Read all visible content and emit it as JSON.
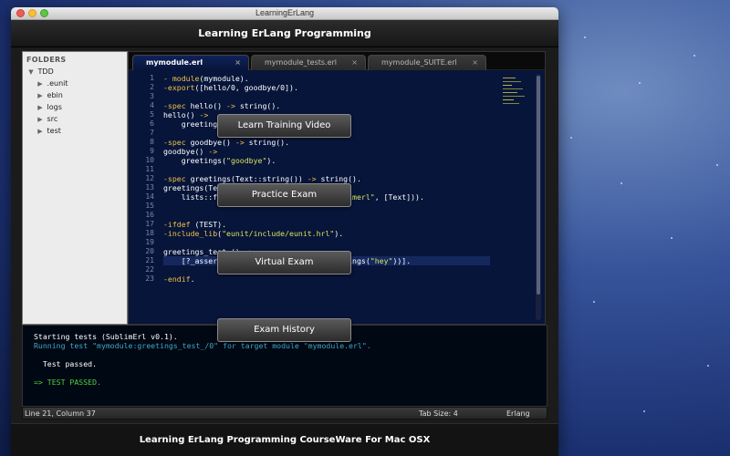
{
  "window": {
    "title": "LearningErLang"
  },
  "header": {
    "title": "Learning ErLang Programming"
  },
  "footer": {
    "title": "Learning ErLang Programming CourseWare For Mac OSX"
  },
  "sidebar": {
    "header": "FOLDERS",
    "items": [
      {
        "label": "TDD",
        "arrow": "▼"
      },
      {
        "label": ".eunit",
        "arrow": "▶"
      },
      {
        "label": "ebin",
        "arrow": "▶"
      },
      {
        "label": "logs",
        "arrow": "▶"
      },
      {
        "label": "src",
        "arrow": "▶"
      },
      {
        "label": "test",
        "arrow": "▶"
      }
    ]
  },
  "tabs": [
    {
      "label": "mymodule.erl",
      "close": "×"
    },
    {
      "label": "mymodule_tests.erl",
      "close": "×"
    },
    {
      "label": "mymodule_SUITE.erl",
      "close": "×"
    }
  ],
  "code": {
    "lines": [
      {
        "n": "1",
        "t": "- module(mymodule)."
      },
      {
        "n": "2",
        "t": "-export([hello/0, goodbye/0])."
      },
      {
        "n": "3",
        "t": ""
      },
      {
        "n": "4",
        "t": "-spec hello() -> string()."
      },
      {
        "n": "5",
        "t": "hello() ->"
      },
      {
        "n": "6",
        "t": "    greetings(\"hello\")."
      },
      {
        "n": "7",
        "t": ""
      },
      {
        "n": "8",
        "t": "-spec goodbye() -> string()."
      },
      {
        "n": "9",
        "t": "goodbye() ->"
      },
      {
        "n": "10",
        "t": "    greetings(\"goodbye\")."
      },
      {
        "n": "11",
        "t": ""
      },
      {
        "n": "12",
        "t": "-spec greetings(Text::string()) -> string()."
      },
      {
        "n": "13",
        "t": "greetings(Text) ->"
      },
      {
        "n": "14",
        "t": "    lists::flatten(io_lib:format(\"~s sublimerl\", [Text]))."
      },
      {
        "n": "15",
        "t": ""
      },
      {
        "n": "16",
        "t": ""
      },
      {
        "n": "17",
        "t": "-ifdef (TEST)."
      },
      {
        "n": "18",
        "t": "-include_lib(\"eunit/include/eunit.hrl\")."
      },
      {
        "n": "19",
        "t": ""
      },
      {
        "n": "20",
        "t": "greetings_test () ->"
      },
      {
        "n": "21",
        "t": "    [?_assertEqual(\"hey sublimerl\", greetings(\"hey\"))]."
      },
      {
        "n": "22",
        "t": ""
      },
      {
        "n": "23",
        "t": "-endif."
      }
    ]
  },
  "console": {
    "lines": [
      {
        "text": "Starting tests (SublimErl v0.1).",
        "color": "#ffffff"
      },
      {
        "text": "Running test \"mymodule:greetings_test_/0\" for target module \"mymodule.erl\".",
        "color": "#3fa9c8"
      },
      {
        "text": "",
        "color": "#ffffff"
      },
      {
        "text": "  Test passed.",
        "color": "#ffffff"
      },
      {
        "text": "",
        "color": "#ffffff"
      },
      {
        "text": "=> TEST PASSED.",
        "color": "#4fd03a"
      }
    ]
  },
  "status": {
    "position": "Line 21, Column 37",
    "tab_size": "Tab Size: 4",
    "syntax": "Erlang"
  },
  "buttons": {
    "training": "Learn Training Video",
    "practice": "Practice Exam",
    "virtual": "Virtual Exam",
    "history": "Exam History"
  },
  "colors": {
    "keyword": "#f0c048",
    "string": "#d7e35b",
    "editor_bg": "#07153a",
    "pass": "#4fd03a"
  }
}
